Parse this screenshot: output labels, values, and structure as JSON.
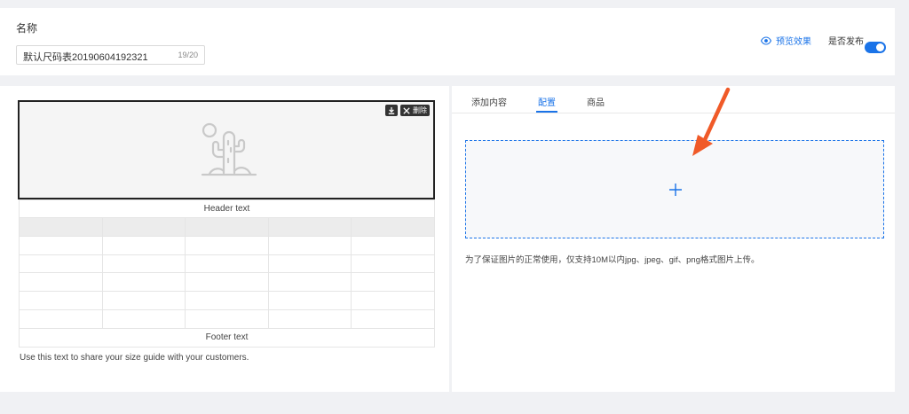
{
  "name_field": {
    "label": "名称",
    "value": "默认尺码表20190604192321",
    "counter": "19/20"
  },
  "header_actions": {
    "preview_label": "预览效果",
    "preview_icon": "eye-icon",
    "publish_label": "是否发布",
    "publish_on": true
  },
  "size_guide": {
    "header_text": "Header text",
    "footer_text": "Footer text",
    "hint": "Use this text to share your size guide with your customers.",
    "delete_label": "删除",
    "image_icon": "cactus-placeholder-icon"
  },
  "tabs": [
    {
      "label": "添加内容",
      "active": false
    },
    {
      "label": "配置",
      "active": true
    },
    {
      "label": "商品",
      "active": false
    }
  ],
  "upload": {
    "hint": "为了保证图片的正常使用，仅支持10M以内jpg、jpeg、gif、png格式图片上传。",
    "icon": "plus-icon"
  },
  "colors": {
    "accent": "#1a73e8",
    "arrow": "#f05a28"
  }
}
